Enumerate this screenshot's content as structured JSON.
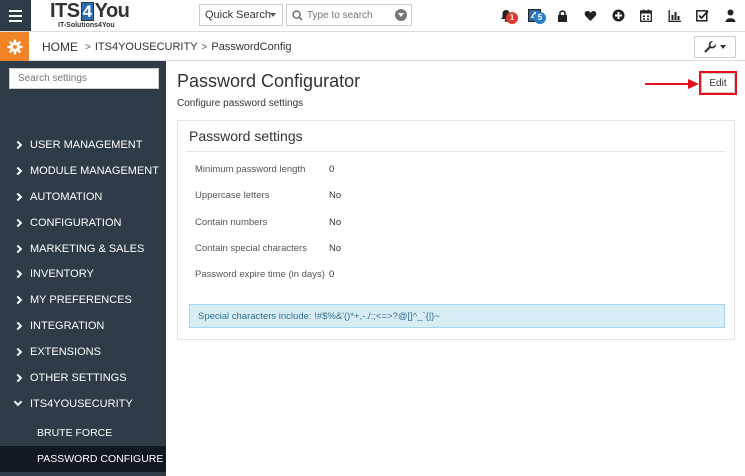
{
  "app": {
    "logo_text_pre": "ITS",
    "logo_text_four": "4",
    "logo_text_post": "You",
    "logo_subtitle": "IT-Solutions4You"
  },
  "topbar": {
    "quick_search_label": "Quick Search",
    "search_placeholder": "Type to search",
    "notifications_count": "1",
    "its4you_count": "5",
    "icons": [
      "bell-icon",
      "its4you-icon",
      "lock-icon",
      "heart-icon",
      "plus-circle-icon",
      "calendar-icon",
      "bar-chart-icon",
      "checkbox-icon",
      "user-icon"
    ]
  },
  "breadcrumb": {
    "home": "HOME",
    "module": "ITS4YOUSECURITY",
    "page": "PasswordConfig"
  },
  "sidebar": {
    "search_placeholder": "Search settings",
    "items": [
      {
        "label": "USER MANAGEMENT"
      },
      {
        "label": "MODULE MANAGEMENT"
      },
      {
        "label": "AUTOMATION"
      },
      {
        "label": "CONFIGURATION"
      },
      {
        "label": "MARKETING & SALES"
      },
      {
        "label": "INVENTORY"
      },
      {
        "label": "MY PREFERENCES"
      },
      {
        "label": "INTEGRATION"
      },
      {
        "label": "EXTENSIONS"
      },
      {
        "label": "OTHER SETTINGS"
      },
      {
        "label": "ITS4YOUSECURITY"
      }
    ],
    "subitems": [
      {
        "label": "BRUTE FORCE"
      },
      {
        "label": "PASSWORD CONFIGURE"
      }
    ]
  },
  "main": {
    "title": "Password Configurator",
    "subtitle": "Configure password settings",
    "edit_label": "Edit",
    "panel_title": "Password settings",
    "settings": [
      {
        "label": "Minimum password length",
        "value": "0"
      },
      {
        "label": "Uppercase letters",
        "value": "No"
      },
      {
        "label": "Contain numbers",
        "value": "No"
      },
      {
        "label": "Contain special characters",
        "value": "No"
      },
      {
        "label": "Password expire time (in days)",
        "value": "0"
      }
    ],
    "info": "Special characters include: !#$%&'()*+,-./:;<=>?@[]^_`{|}~"
  },
  "colors": {
    "sidebar_bg": "#2f3b47",
    "accent_orange": "#f08427",
    "highlight_red": "#e3111b",
    "info_bg": "#d9edf7"
  }
}
